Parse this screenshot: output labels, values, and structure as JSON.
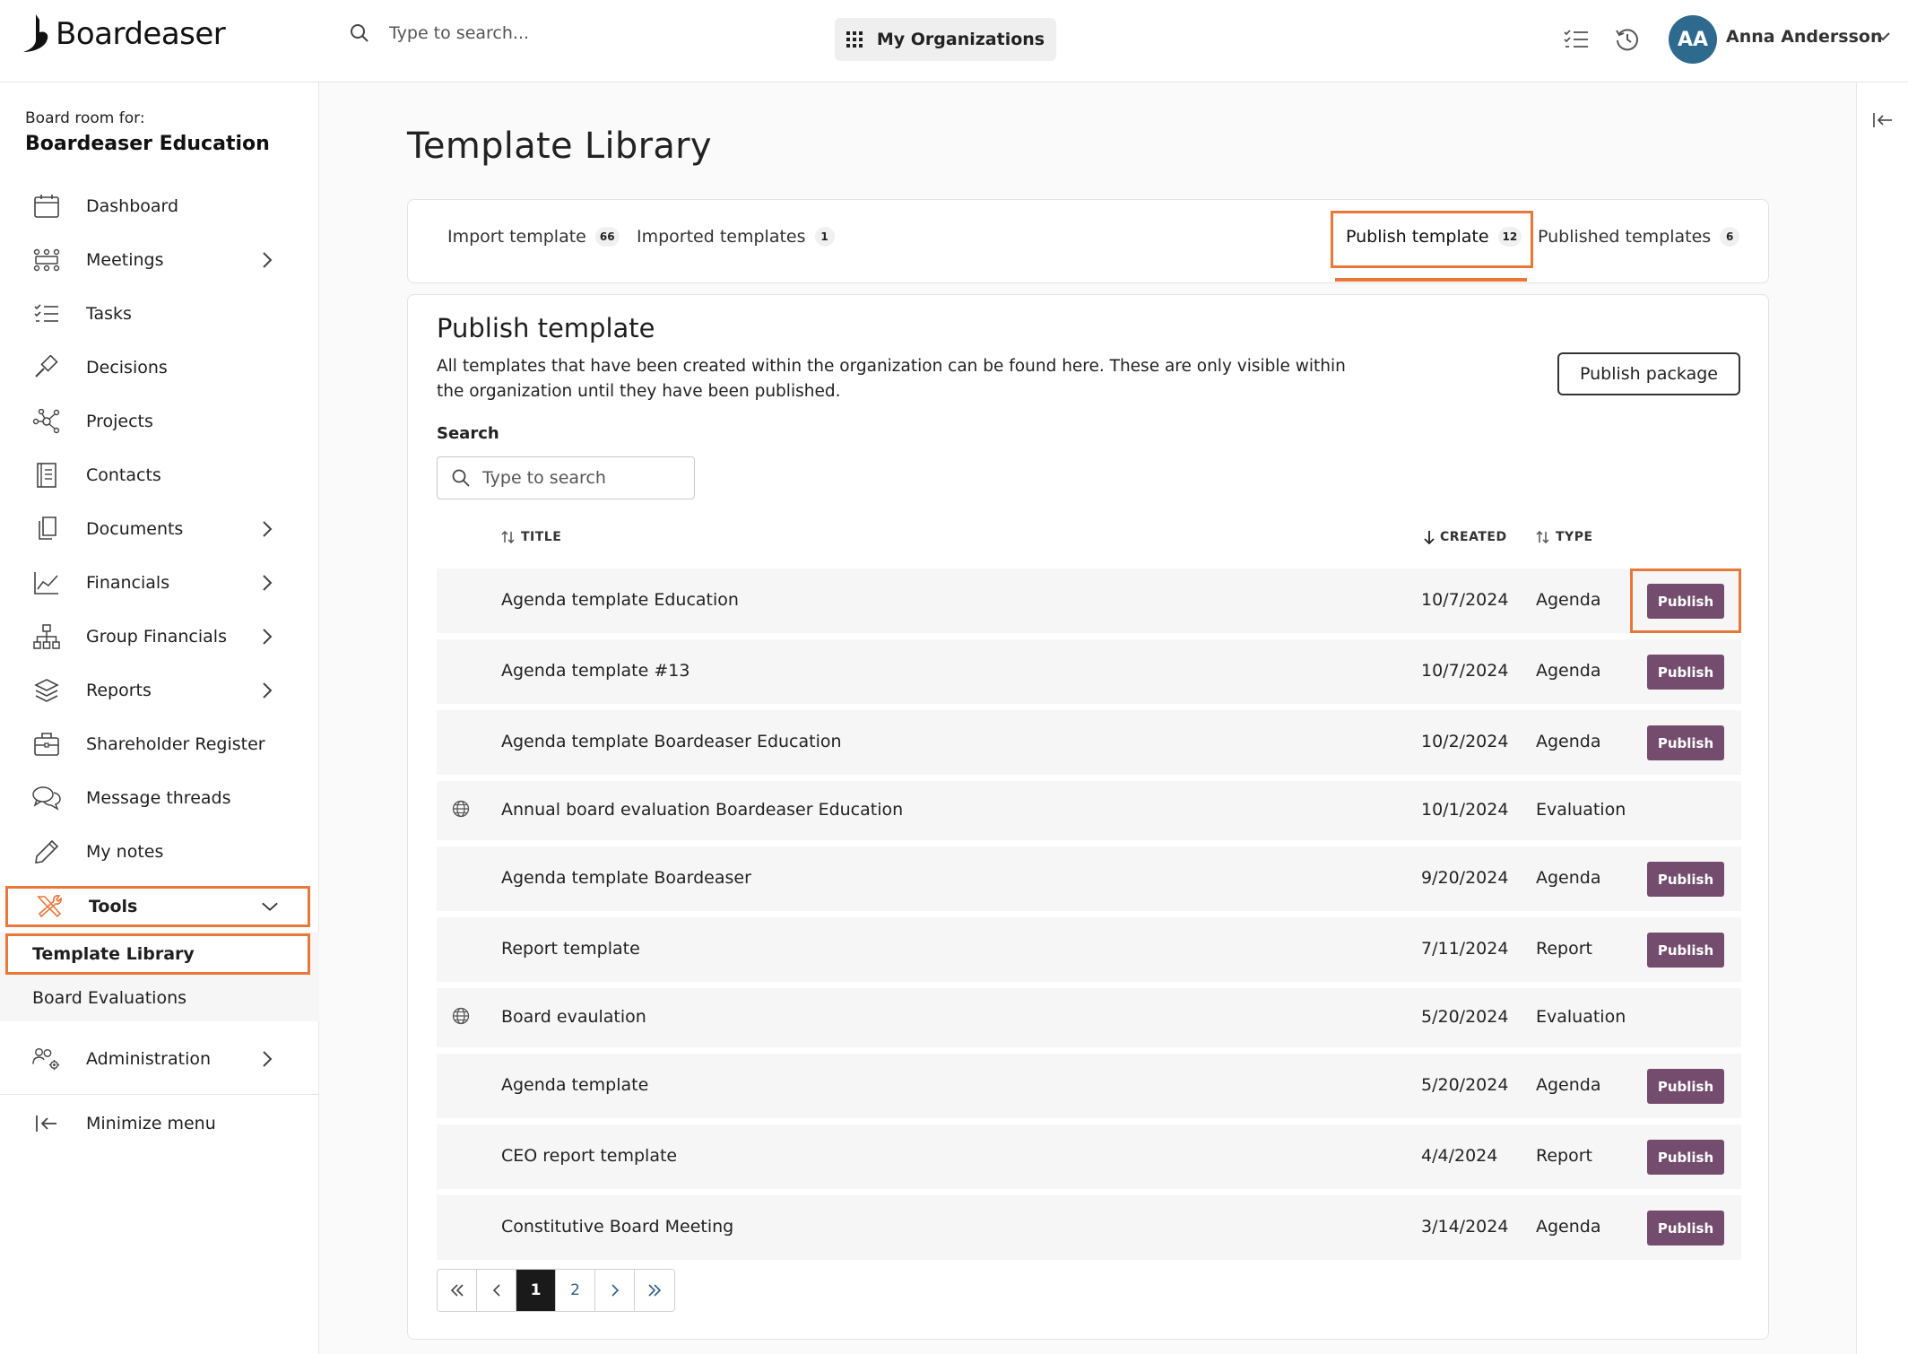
{
  "app": {
    "name": "Boardeaser"
  },
  "topbar": {
    "search_placeholder": "Type to search...",
    "org_button": "My Organizations",
    "user_initials": "AA",
    "user_name": "Anna Andersson"
  },
  "sidebar": {
    "board_label": "Board room for:",
    "board_name": "Boardeaser Education",
    "items": [
      {
        "label": "Dashboard",
        "icon": "calendar-icon"
      },
      {
        "label": "Meetings",
        "icon": "meeting-icon"
      },
      {
        "label": "Tasks",
        "icon": "checklist-icon"
      },
      {
        "label": "Decisions",
        "icon": "gavel-icon"
      },
      {
        "label": "Projects",
        "icon": "network-icon"
      },
      {
        "label": "Contacts",
        "icon": "address-book-icon"
      },
      {
        "label": "Documents",
        "icon": "documents-icon"
      },
      {
        "label": "Financials",
        "icon": "chart-icon"
      },
      {
        "label": "Group Financials",
        "icon": "hierarchy-icon"
      },
      {
        "label": "Reports",
        "icon": "layers-icon"
      },
      {
        "label": "Shareholder Register",
        "icon": "briefcase-icon"
      },
      {
        "label": "Message threads",
        "icon": "chat-icon"
      },
      {
        "label": "My notes",
        "icon": "pencil-icon"
      },
      {
        "label": "Tools",
        "icon": "tools-icon"
      }
    ],
    "tools_submenu": [
      "Template Library",
      "Board Evaluations"
    ],
    "administration": "Administration",
    "minimize": "Minimize menu"
  },
  "page": {
    "title": "Template Library",
    "tabs": [
      {
        "label": "Import template",
        "count": "66"
      },
      {
        "label": "Imported templates",
        "count": "1"
      },
      {
        "label": "Publish template",
        "count": "12"
      },
      {
        "label": "Published templates",
        "count": "6"
      }
    ],
    "section_title": "Publish template",
    "section_desc": "All templates that have been created within the organization can be found here. These are only visible within the organization until they have been published.",
    "publish_package": "Publish package",
    "search_label": "Search",
    "search_placeholder": "Type to search",
    "columns": {
      "title": "TITLE",
      "created": "CREATED",
      "type": "TYPE"
    },
    "publish_label": "Publish",
    "rows": [
      {
        "title": "Agenda template Education",
        "created": "10/7/2024",
        "type": "Agenda",
        "published": false
      },
      {
        "title": "Agenda template #13",
        "created": "10/7/2024",
        "type": "Agenda",
        "published": false
      },
      {
        "title": "Agenda template Boardeaser Education",
        "created": "10/2/2024",
        "type": "Agenda",
        "published": false
      },
      {
        "title": "Annual board evaluation Boardeaser Education",
        "created": "10/1/2024",
        "type": "Evaluation",
        "published": true
      },
      {
        "title": "Agenda template Boardeaser",
        "created": "9/20/2024",
        "type": "Agenda",
        "published": false
      },
      {
        "title": "Report template",
        "created": "7/11/2024",
        "type": "Report",
        "published": false
      },
      {
        "title": "Board evaulation",
        "created": "5/20/2024",
        "type": "Evaluation",
        "published": true
      },
      {
        "title": "Agenda template",
        "created": "5/20/2024",
        "type": "Agenda",
        "published": false
      },
      {
        "title": "CEO report template",
        "created": "4/4/2024",
        "type": "Report",
        "published": false
      },
      {
        "title": "Constitutive Board Meeting",
        "created": "3/14/2024",
        "type": "Agenda",
        "published": false
      }
    ],
    "pagination": {
      "pages": [
        "1",
        "2"
      ],
      "current": "1"
    }
  },
  "colors": {
    "accent_highlight": "#e8773a",
    "publish_button": "#744c6e",
    "avatar": "#2e6a8e"
  }
}
